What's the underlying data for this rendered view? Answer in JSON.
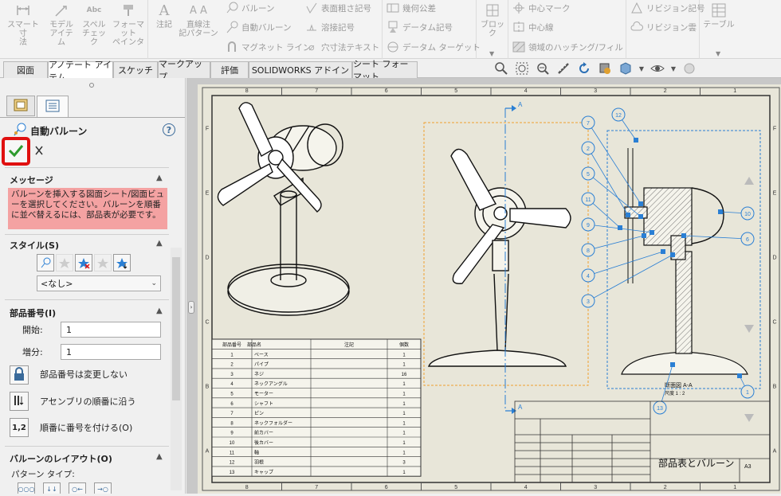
{
  "ribbon": {
    "smart_dimension": "スマート寸\n法",
    "model_items": "モデル\nアイテム",
    "spell_check": "スペル\nチェック",
    "format_painter": "フォーマット\nペインタ",
    "note": "注記",
    "linear_note_pattern": "直線注\n記パターン",
    "balloon": "バルーン",
    "auto_balloon": "自動バルーン",
    "magnetic_line": "マグネット ライン",
    "surface_finish": "表面粗さ記号",
    "weld_symbol": "溶接記号",
    "hole_callout": "穴寸法テキスト",
    "geometric_tolerance": "幾何公差",
    "datum_feature": "データム記号",
    "datum_target": "データム ターゲット",
    "block": "ブロック",
    "center_mark": "中心マーク",
    "centerline": "中心線",
    "area_hatch": "領域のハッチング/フィル",
    "revision_symbol": "リビジョン記号",
    "revision_cloud": "リビジョン雲",
    "table": "テーブル"
  },
  "tabs": [
    {
      "label": "図面"
    },
    {
      "label": "アノテート アイテム"
    },
    {
      "label": "スケッチ"
    },
    {
      "label": "マークアップ"
    },
    {
      "label": "評価"
    },
    {
      "label": "SOLIDWORKS アドイン"
    },
    {
      "label": "シート フォーマット"
    }
  ],
  "panel": {
    "title": "自動バルーン",
    "message_title": "メッセージ",
    "message_text": "バルーンを挿入する図面シート/図面ビューを選択してください。バルーンを順番に並べ替えるには、部品表が必要です。",
    "style_title": "スタイル(S)",
    "style_value": "<なし>",
    "item_number_title": "部品番号(I)",
    "start_label": "開始:",
    "start_value": "1",
    "increment_label": "増分:",
    "increment_value": "1",
    "opt_no_change": "部品番号は変更しない",
    "opt_follow_assembly": "アセンブリの順番に沿う",
    "opt_sequential": "順番に番号を付ける(O)",
    "layout_title": "バルーンのレイアウト(O)",
    "pattern_type": "パターン タイプ:"
  },
  "drawing": {
    "col_labels": [
      "8",
      "7",
      "6",
      "5",
      "4",
      "3",
      "2",
      "1"
    ],
    "row_labels": [
      "F",
      "E",
      "D",
      "C",
      "B",
      "A"
    ],
    "section_label": "A",
    "section_caption": "断面図 A-A",
    "section_scale": "尺度 1 : 2",
    "title_block_name": "部品表とバルーン",
    "sheet_size": "A3",
    "bom_headers": [
      "部品番号",
      "部品名",
      "注記",
      "個数"
    ],
    "bom_rows": [
      [
        "1",
        "ベース",
        "",
        "1"
      ],
      [
        "2",
        "パイプ",
        "",
        "1"
      ],
      [
        "3",
        "ネジ",
        "",
        "16"
      ],
      [
        "4",
        "ネックアングル",
        "",
        "1"
      ],
      [
        "5",
        "モーター",
        "",
        "1"
      ],
      [
        "6",
        "シャフト",
        "",
        "1"
      ],
      [
        "7",
        "ピン",
        "",
        "1"
      ],
      [
        "8",
        "ネックフォルダー",
        "",
        "1"
      ],
      [
        "9",
        "前カバー",
        "",
        "1"
      ],
      [
        "10",
        "後カバー",
        "",
        "1"
      ],
      [
        "11",
        "軸",
        "",
        "1"
      ],
      [
        "12",
        "羽根",
        "",
        "3"
      ],
      [
        "13",
        "キャップ",
        "",
        "1"
      ]
    ],
    "balloons_left": [
      "7",
      "2",
      "5",
      "11",
      "9",
      "8",
      "4",
      "3"
    ],
    "balloons_right": [
      "10",
      "6"
    ],
    "balloon_top": "12",
    "balloon_bottom_right": "1",
    "balloon_bottom": "13"
  },
  "colors": {
    "message_bg": "#f4a2a2",
    "confirm_green": "#2e9b2e",
    "highlight_red": "#e01010",
    "balloon_blue": "#2a7fd4",
    "view_orange": "#f0a030",
    "sheet_bg": "#e8e6d9"
  }
}
